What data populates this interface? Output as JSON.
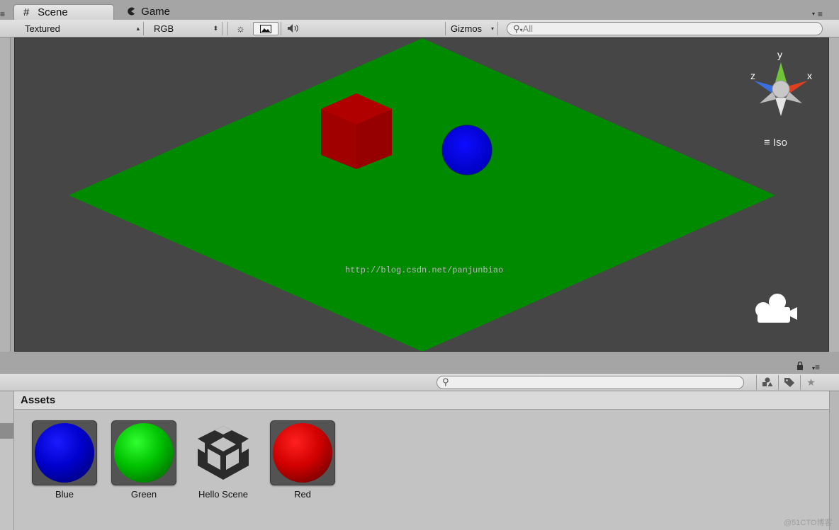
{
  "tabs": [
    {
      "label": "Scene",
      "icon": "grid-icon",
      "active": true
    },
    {
      "label": "Game",
      "icon": "pacman-icon",
      "active": false
    }
  ],
  "scene_toolbar": {
    "draw_mode": "Textured",
    "render_mode": "RGB",
    "gizmos_label": "Gizmos",
    "search_placeholder": "All",
    "buttons": [
      "sun-icon",
      "image-icon",
      "speaker-icon"
    ]
  },
  "scene_view": {
    "projection_label": "Iso",
    "gizmo_axes": {
      "x": "x",
      "y": "y",
      "z": "z"
    },
    "watermark": "http://blog.csdn.net/panjunbiao",
    "colors": {
      "background": "#464646",
      "plane": "#008a00",
      "cube": "#a80000",
      "sphere": "#0000d8"
    }
  },
  "project_toolbar": {
    "search_placeholder": "",
    "buttons": [
      "shapes-icon",
      "tag-icon",
      "star-icon"
    ]
  },
  "assets": {
    "header": "Assets",
    "items": [
      {
        "label": "Blue",
        "type": "material",
        "color": "#0000e0"
      },
      {
        "label": "Green",
        "type": "material",
        "color": "#00d000"
      },
      {
        "label": "Hello Scene",
        "type": "scene",
        "icon": "unity-logo-icon"
      },
      {
        "label": "Red",
        "type": "material",
        "color": "#e00000"
      }
    ]
  },
  "bottom_watermark": "@51CTO博客"
}
